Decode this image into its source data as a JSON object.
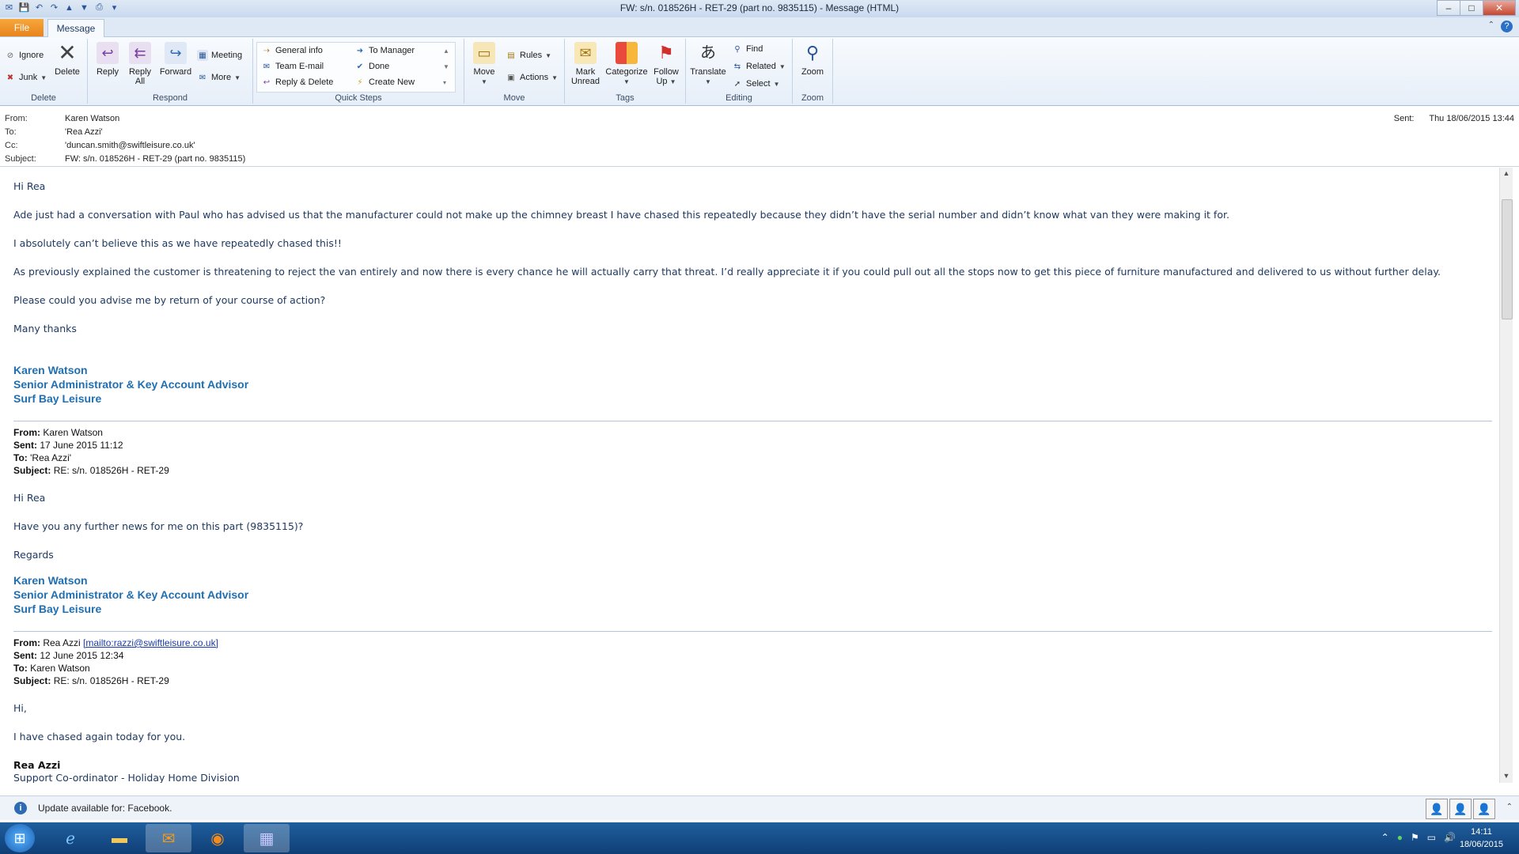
{
  "window": {
    "title": "FW: s/n. 018526H - RET-29 (part no. 9835115)  -  Message (HTML)",
    "controls": {
      "minimize": "–",
      "maximize": "□",
      "close": "✕"
    }
  },
  "tabs": {
    "file": "File",
    "message": "Message"
  },
  "ribbon": {
    "delete_group": {
      "label": "Delete",
      "ignore": "Ignore",
      "junk": "Junk",
      "delete": "Delete"
    },
    "respond_group": {
      "label": "Respond",
      "reply": "Reply",
      "reply_all": "Reply All",
      "forward": "Forward",
      "meeting": "Meeting",
      "more": "More"
    },
    "quick_steps_group": {
      "label": "Quick Steps",
      "general_info": "General info",
      "team_email": "Team E-mail",
      "reply_delete": "Reply & Delete",
      "to_manager": "To Manager",
      "done": "Done",
      "create_new": "Create New"
    },
    "move_group": {
      "label": "Move",
      "move": "Move",
      "rules": "Rules",
      "actions": "Actions"
    },
    "tags_group": {
      "label": "Tags",
      "mark_unread": "Mark Unread",
      "categorize": "Categorize",
      "follow_up": "Follow Up"
    },
    "editing_group": {
      "label": "Editing",
      "translate": "Translate",
      "find": "Find",
      "related": "Related",
      "select": "Select"
    },
    "zoom_group": {
      "label": "Zoom",
      "zoom": "Zoom"
    }
  },
  "header": {
    "from_label": "From:",
    "from": "Karen Watson",
    "to_label": "To:",
    "to": "'Rea Azzi'",
    "cc_label": "Cc:",
    "cc": "'duncan.smith@swiftleisure.co.uk'",
    "subject_label": "Subject:",
    "subject": "FW: s/n. 018526H - RET-29 (part no. 9835115)",
    "sent_label": "Sent:",
    "sent": "Thu 18/06/2015 13:44"
  },
  "body": {
    "greeting": "Hi Rea",
    "p1": "Ade just had a conversation with Paul who has advised us that the manufacturer could not make up the chimney breast I have chased this repeatedly because they didn’t have the serial number and didn’t know what van they were making it for.",
    "p2": "I absolutely can’t believe this as we have repeatedly chased this!!",
    "p3": "As previously explained the customer is threatening to reject the van entirely and now there is every chance he will actually carry that threat.  I’d really appreciate it if you could pull out all the stops now to get this piece of furniture manufactured and delivered to us without further delay.",
    "p4": "Please could you advise me by return of your course of action?",
    "closing": "Many thanks",
    "sig_name": "Karen Watson",
    "sig_title": "Senior Administrator & Key Account Advisor",
    "sig_company": "Surf Bay Leisure",
    "q1": {
      "from_label": "From:",
      "from": "Karen Watson",
      "sent_label": "Sent:",
      "sent": "17 June 2015 11:12",
      "to_label": "To:",
      "to": "'Rea Azzi'",
      "subject_label": "Subject:",
      "subject": "RE: s/n. 018526H - RET-29",
      "greeting": "Hi Rea",
      "text": "Have you any further news for me on this part (9835115)?",
      "closing": "Regards",
      "sig_name": "Karen Watson",
      "sig_title": "Senior Administrator & Key Account Advisor",
      "sig_company": "Surf Bay Leisure"
    },
    "q2": {
      "from_label": "From:",
      "from": "Rea Azzi",
      "mailto": "[mailto:razzi@swiftleisure.co.uk]",
      "sent_label": "Sent:",
      "sent": "12 June 2015 12:34",
      "to_label": "To:",
      "to": "Karen Watson",
      "subject_label": "Subject:",
      "subject": "RE: s/n. 018526H - RET-29",
      "greeting": "Hi,",
      "text": "I have chased again today for you.",
      "sig_name": "Rea Azzi",
      "sig_title": "Support Co-ordinator - Holiday Home Division"
    }
  },
  "infobar": {
    "text": "Update available for: Facebook."
  },
  "taskbar": {
    "time": "14:11",
    "date": "18/06/2015"
  }
}
